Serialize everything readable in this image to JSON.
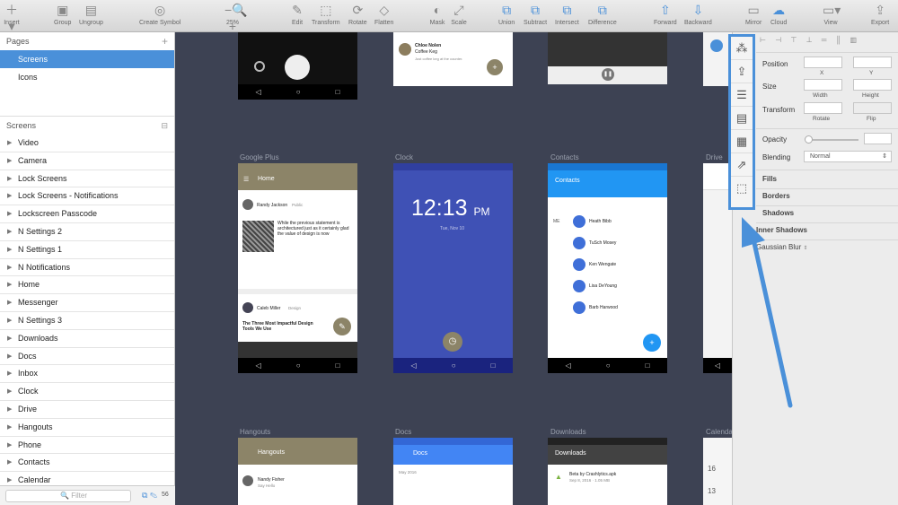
{
  "toolbar": {
    "insert": "Insert",
    "group": "Group",
    "ungroup": "Ungroup",
    "create_symbol": "Create Symbol",
    "zoom": "25%",
    "edit": "Edit",
    "transform": "Transform",
    "rotate": "Rotate",
    "flatten": "Flatten",
    "mask": "Mask",
    "scale": "Scale",
    "union": "Union",
    "subtract": "Subtract",
    "intersect": "Intersect",
    "difference": "Difference",
    "forward": "Forward",
    "backward": "Backward",
    "mirror": "Mirror",
    "cloud": "Cloud",
    "view": "View",
    "export": "Export"
  },
  "sidebar": {
    "pages_title": "Pages",
    "pages": [
      "Screens",
      "Icons"
    ],
    "layers_title": "Screens",
    "layers": [
      "Video",
      "Camera",
      "Lock Screens",
      "Lock Screens - Notifications",
      "Lockscreen Passcode",
      "N Settings 2",
      "N Settings 1",
      "N Notifications",
      "Home",
      "Messenger",
      "N Settings 3",
      "Downloads",
      "Docs",
      "Inbox",
      "Clock",
      "Drive",
      "Hangouts",
      "Phone",
      "Contacts",
      "Calendar"
    ],
    "filter_placeholder": "Filter",
    "count": "56"
  },
  "artboards": {
    "google_plus": {
      "label": "Google Plus",
      "title": "Home",
      "author": "Randy Jackson",
      "visibility": "Public",
      "post": "While the previous statement is architectured just as it certainly glad the value of design is now",
      "author2": "Caleb Miller",
      "community": "Design",
      "post2": "The Three Most Impactful Design Tools We Use"
    },
    "clock": {
      "label": "Clock",
      "time": "12:13",
      "ampm": "PM",
      "date": "Tue, Nov 10"
    },
    "contacts": {
      "label": "Contacts",
      "title": "Contacts",
      "me": "ME",
      "people": [
        "Heath Bibb",
        "TuSch Mosey",
        "Ken Wengate",
        "Lisa DeYoung",
        "Barb Harwood"
      ]
    },
    "drive": {
      "label": "Drive"
    },
    "hangouts": {
      "label": "Hangouts",
      "title": "Hangouts",
      "person": "Nandy Fisher",
      "sub": "Say Hello"
    },
    "docs": {
      "label": "Docs",
      "title": "Docs",
      "date": "May 2016"
    },
    "downloads": {
      "label": "Downloads",
      "title": "Downloads",
      "file": "Beta by Crashlytics.apk",
      "meta": "Sep 8, 2016 · 1.05 MB"
    },
    "calendar": {
      "label": "Calendar",
      "d1": "16",
      "d2": "13"
    },
    "top_card": {
      "name": "Chloe Nolen",
      "sub": "Coffee Keg",
      "caption": "Just coffee keg at the counter."
    }
  },
  "inspector": {
    "position": "Position",
    "x": "X",
    "y": "Y",
    "size": "Size",
    "width": "Width",
    "height": "Height",
    "transform": "Transform",
    "rotate": "Rotate",
    "flip": "Flip",
    "opacity": "Opacity",
    "blending": "Blending",
    "blending_value": "Normal",
    "fills": "Fills",
    "borders": "Borders",
    "shadows": "Shadows",
    "inner_shadows": "Inner Shadows",
    "gaussian_blur": "Gaussian Blur"
  },
  "colors": {
    "accent": "#4a90d9",
    "canvas": "#3d4253",
    "clock_bg": "#3f51b5",
    "contacts_bar": "#2196f3",
    "gplus_bar": "#8c8468"
  }
}
